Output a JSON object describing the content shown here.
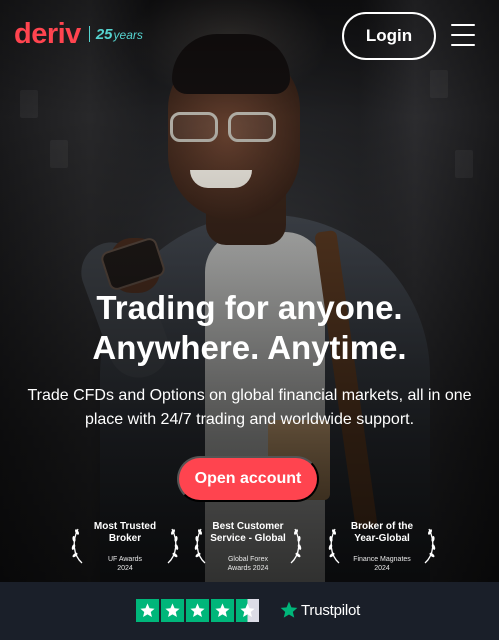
{
  "brand": {
    "logo_text": "deriv",
    "anniversary_number": "25",
    "anniversary_text": "years",
    "primary_color": "#ff444f",
    "accent_color": "#56d4d0"
  },
  "header": {
    "login_label": "Login",
    "menu_icon": "hamburger-menu-icon"
  },
  "hero": {
    "headline_line1": "Trading for anyone.",
    "headline_line2": "Anywhere. Anytime.",
    "subtext": "Trade CFDs and Options on global financial markets, all in one place with 24/7 trading and worldwide support.",
    "cta_label": "Open account"
  },
  "awards": [
    {
      "title": "Most Trusted Broker",
      "source_line1": "UF Awards",
      "source_line2": "2024"
    },
    {
      "title": "Best Customer Service - Global",
      "source_line1": "Global Forex",
      "source_line2": "Awards 2024"
    },
    {
      "title": "Broker of the Year-Global",
      "source_line1": "Finance Magnates",
      "source_line2": "2024"
    }
  ],
  "trustpilot": {
    "rating_stars": 4.5,
    "brand_label": "Trustpilot",
    "star_color": "#00b67a"
  }
}
